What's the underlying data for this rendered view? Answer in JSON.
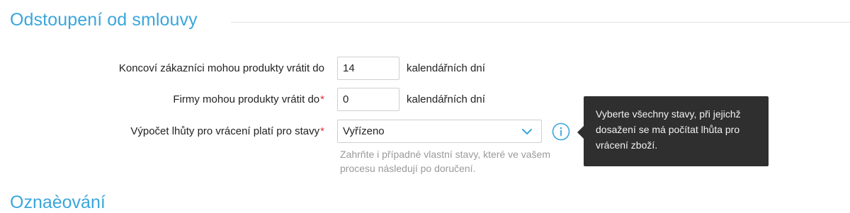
{
  "section": {
    "title": "Odstoupení od smlouvy",
    "next_title": "Oznaèování"
  },
  "form": {
    "end_customers": {
      "label": "Koncoví zákazníci mohou produkty vrátit do",
      "value": "14",
      "unit": "kalendářních dní"
    },
    "companies": {
      "label": "Firmy mohou produkty vrátit do",
      "required_mark": "*",
      "value": "0",
      "unit": "kalendářních dní"
    },
    "statuses": {
      "label": "Výpočet lhůty pro vrácení platí pro stavy",
      "required_mark": "*",
      "selected": "Vyřízeno",
      "hint": "Zahrňte i případné vlastní stavy, které ve vašem procesu následují po doručení."
    }
  },
  "tooltip": {
    "text": "Vyberte všechny stavy, při jejichž dosažení se má počítat lhůta pro vrácení zboží."
  },
  "icons": {
    "select_chevron": "chevron-down-icon",
    "info": "info-icon"
  },
  "colors": {
    "accent": "#3aa6dc",
    "required": "#e0303a",
    "tooltip_bg": "#2f2f2f"
  }
}
